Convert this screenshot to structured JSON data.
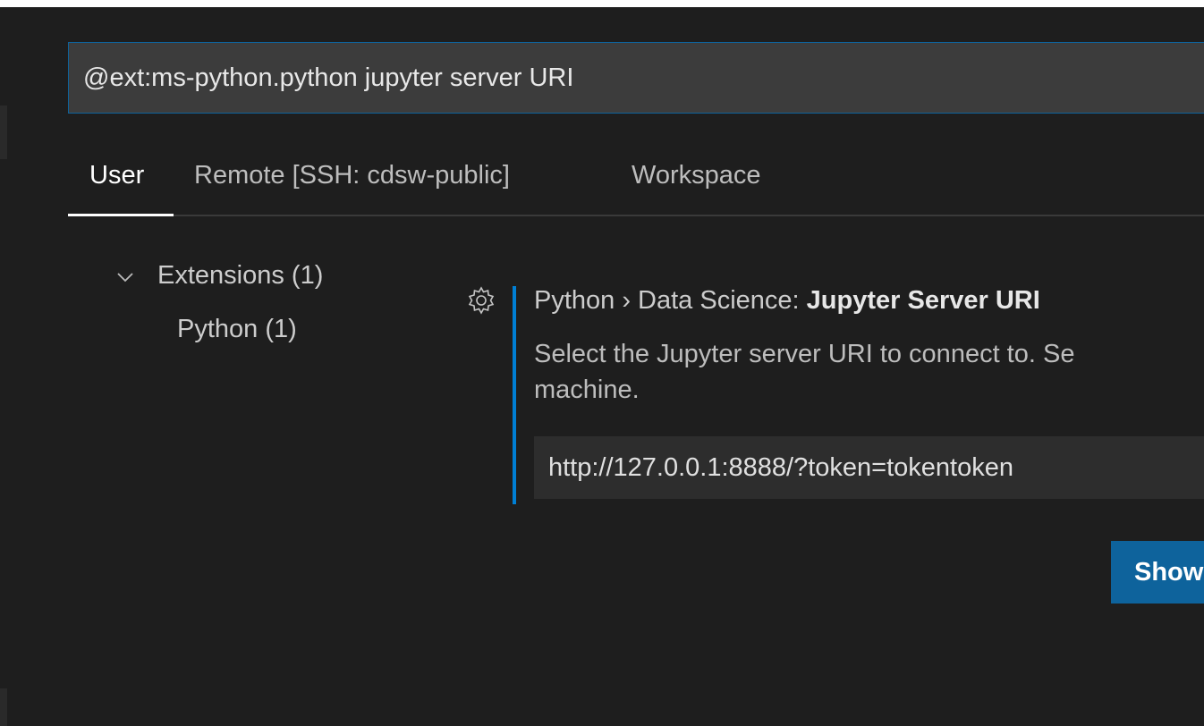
{
  "search": {
    "value": "@ext:ms-python.python jupyter server URI"
  },
  "tabs": [
    {
      "label": "User",
      "active": true
    },
    {
      "label": "Remote [SSH: cdsw-public]",
      "active": false
    },
    {
      "label": "Workspace",
      "active": false
    }
  ],
  "toc": {
    "items": [
      {
        "label": "Extensions (1)",
        "expanded": true,
        "icon": "chevron-down-icon"
      },
      {
        "label": "Python (1)"
      }
    ]
  },
  "setting": {
    "gear_icon": "gear-icon",
    "category": "Python › Data Science: ",
    "name": "Jupyter Server URI",
    "description_line1": "Select the Jupyter server URI to connect to. Se",
    "description_line2": "machine.",
    "value": "http://127.0.0.1:8888/?token=tokentoken"
  },
  "button": {
    "label": "Show"
  },
  "colors": {
    "background": "#1e1e1e",
    "accent": "#007fd4",
    "button": "#0e639c",
    "input_border": "#0e639c"
  }
}
